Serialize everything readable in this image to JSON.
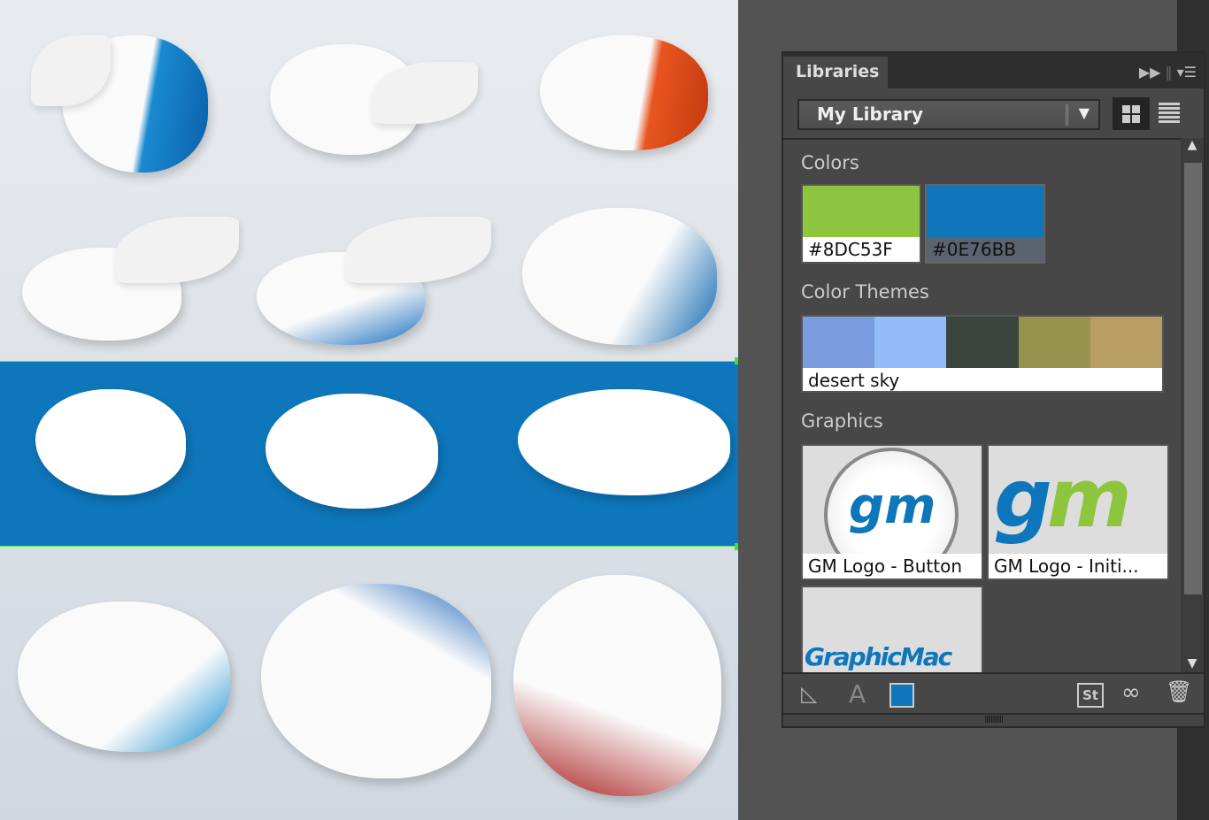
{
  "panel": {
    "tab": "Libraries",
    "library": "My Library"
  },
  "sections": {
    "colors": "Colors",
    "themes": "Color Themes",
    "graphics": "Graphics"
  },
  "colors": [
    {
      "hex": "#8DC53F",
      "label": "#8DC53F"
    },
    {
      "hex": "#0E76BB",
      "label": "#0E76BB"
    }
  ],
  "theme": {
    "name": "desert sky",
    "swatches": [
      "#7a9de2",
      "#93bcf8",
      "#3b453e",
      "#97934e",
      "#b89e63"
    ]
  },
  "graphics": [
    {
      "label": "GM Logo - Button"
    },
    {
      "label": "GM Logo - Initi..."
    },
    {
      "label": "",
      "logo_text": "GraphicMac"
    }
  ],
  "logo": {
    "text": "gm",
    "green": "#8DC53F",
    "blue": "#0E76BB"
  },
  "footer": {
    "text_icon": "A",
    "stock": "St",
    "fill_color": "#0E76BB"
  }
}
